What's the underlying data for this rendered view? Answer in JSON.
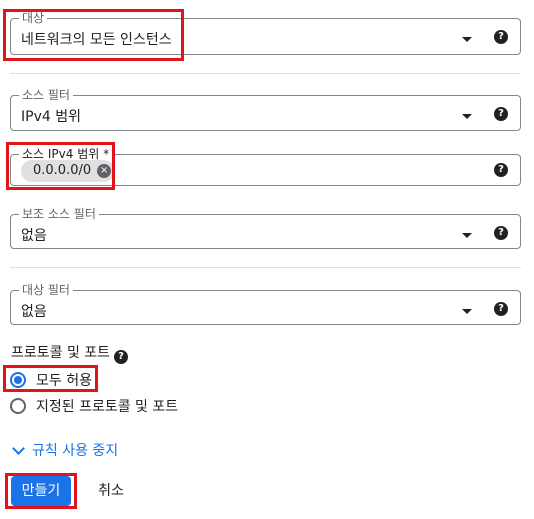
{
  "fields": {
    "target": {
      "label": "대상",
      "value": "네트워크의 모든 인스턴스"
    },
    "source_filter": {
      "label": "소스 필터",
      "value": "IPv4 범위"
    },
    "source_ipv4": {
      "label": "소스 IPv4 범위 *",
      "chip": "0.0.0.0/0"
    },
    "secondary_source_filter": {
      "label": "보조 소스 필터",
      "value": "없음"
    },
    "target_filter": {
      "label": "대상 필터",
      "value": "없음"
    }
  },
  "protocols": {
    "title": "프로토콜 및 포트",
    "options": [
      {
        "label": "모두 허용",
        "checked": true
      },
      {
        "label": "지정된 프로토콜 및 포트",
        "checked": false
      }
    ]
  },
  "toggle_rule": "규칙 사용 중지",
  "actions": {
    "create": "만들기",
    "cancel": "취소"
  },
  "icons": {
    "help": "?",
    "chip_remove": "×"
  },
  "colors": {
    "accent": "#1a73e8",
    "highlight": "#e0151b"
  }
}
